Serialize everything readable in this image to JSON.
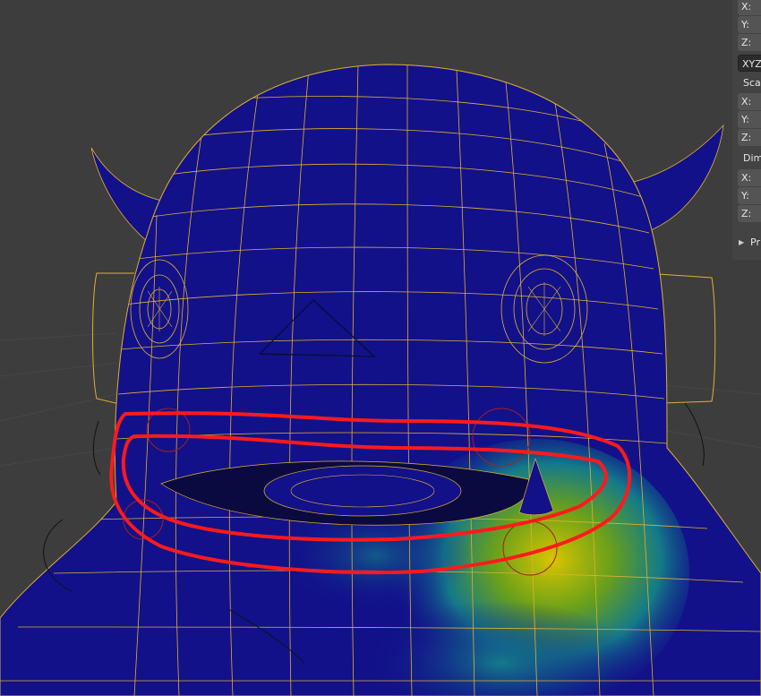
{
  "panel": {
    "location": {
      "x": "X:",
      "y": "Y:",
      "z": "Z:"
    },
    "rotation_mode": "XYZ",
    "scale": {
      "label": "Sca",
      "x": "X:",
      "y": "Y:",
      "z": "Z:"
    },
    "dimensions": {
      "label": "Dim",
      "x": "X:",
      "y": "Y:",
      "z": "Z:"
    },
    "section_label": "Pr"
  },
  "viewport": {
    "background": "#3d3d3d",
    "mesh_color": "#12118a",
    "wire_color": "#e0b030",
    "annotation_color": "#ff1a1a"
  }
}
